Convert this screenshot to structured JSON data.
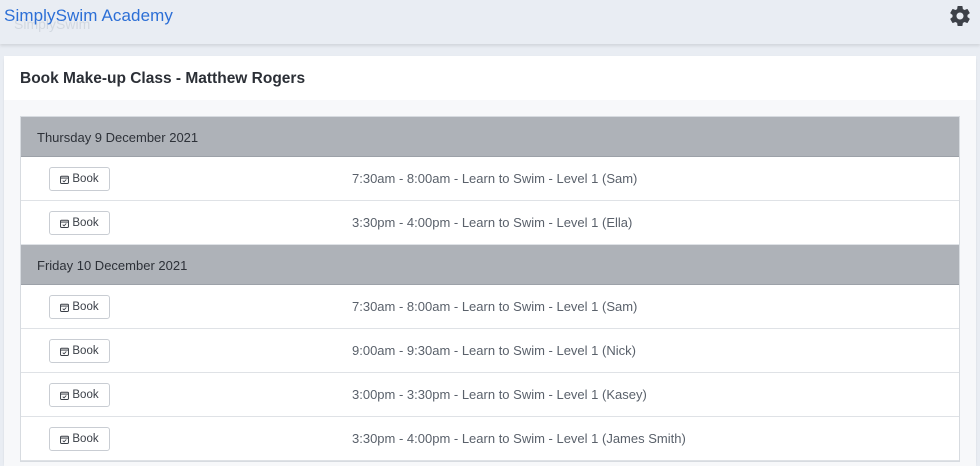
{
  "app": {
    "brand": "SimplySwim Academy",
    "ghost_text": "SimplySwim",
    "settings_icon": "gear-icon"
  },
  "page": {
    "title": "Book Make-up Class - Matthew Rogers"
  },
  "colors": {
    "brand": "#2c6fd6",
    "day_header_bg": "#aeb2b8",
    "topbar_bg": "#e9edf3"
  },
  "days": [
    {
      "date": "Thursday 9 December 2021",
      "slots": [
        {
          "button": "Book",
          "icon": "calendar-check-icon",
          "label": "7:30am - 8:00am - Learn to Swim - Level 1 (Sam)"
        },
        {
          "button": "Book",
          "icon": "calendar-check-icon",
          "label": "3:30pm - 4:00pm - Learn to Swim - Level 1 (Ella)"
        }
      ]
    },
    {
      "date": "Friday 10 December 2021",
      "slots": [
        {
          "button": "Book",
          "icon": "calendar-check-icon",
          "label": "7:30am - 8:00am - Learn to Swim - Level 1 (Sam)"
        },
        {
          "button": "Book",
          "icon": "calendar-check-icon",
          "label": "9:00am - 9:30am - Learn to Swim - Level 1 (Nick)"
        },
        {
          "button": "Book",
          "icon": "calendar-check-icon",
          "label": "3:00pm - 3:30pm - Learn to Swim - Level 1 (Kasey)"
        },
        {
          "button": "Book",
          "icon": "calendar-check-icon",
          "label": "3:30pm - 4:00pm - Learn to Swim - Level 1 (James Smith)"
        }
      ]
    }
  ]
}
